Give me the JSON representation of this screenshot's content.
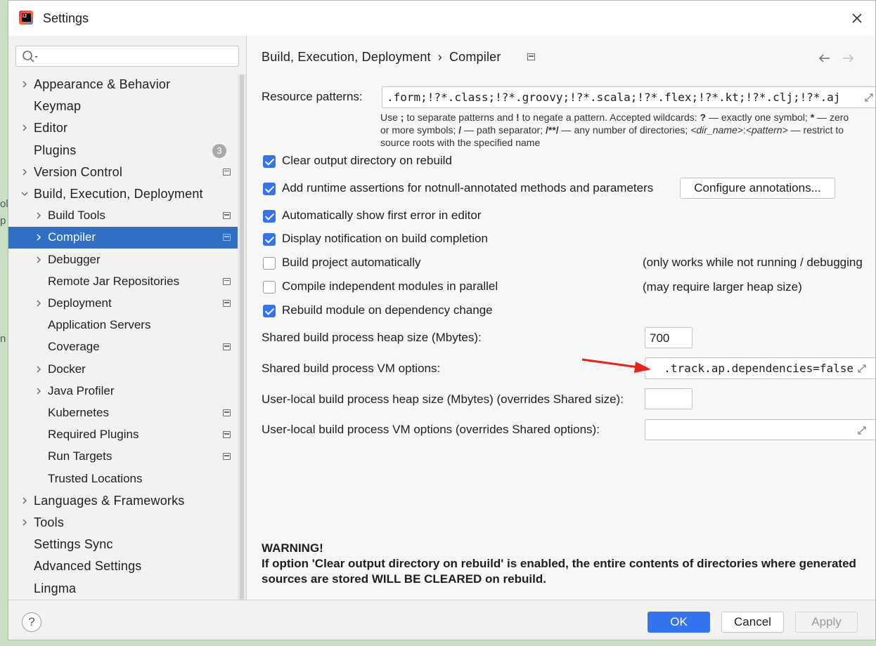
{
  "window": {
    "title": "Settings"
  },
  "background_text": [
    "ol",
    "p",
    "n"
  ],
  "sidebar": {
    "search_placeholder": "",
    "items": [
      {
        "label": "Appearance & Behavior",
        "level": 0,
        "expandable": true
      },
      {
        "label": "Keymap",
        "level": 0,
        "expandable": false
      },
      {
        "label": "Editor",
        "level": 0,
        "expandable": true
      },
      {
        "label": "Plugins",
        "level": 0,
        "expandable": false,
        "badge": "3"
      },
      {
        "label": "Version Control",
        "level": 0,
        "expandable": true,
        "project_icon": true
      },
      {
        "label": "Build, Execution, Deployment",
        "level": 0,
        "expanded": true
      },
      {
        "label": "Build Tools",
        "level": 1,
        "expandable": true,
        "project_icon": true
      },
      {
        "label": "Compiler",
        "level": 1,
        "expandable": true,
        "project_icon": true,
        "selected": true
      },
      {
        "label": "Debugger",
        "level": 1,
        "expandable": true
      },
      {
        "label": "Remote Jar Repositories",
        "level": 1,
        "project_icon": true
      },
      {
        "label": "Deployment",
        "level": 1,
        "expandable": true,
        "project_icon": true
      },
      {
        "label": "Application Servers",
        "level": 1
      },
      {
        "label": "Coverage",
        "level": 1,
        "project_icon": true
      },
      {
        "label": "Docker",
        "level": 1,
        "expandable": true
      },
      {
        "label": "Java Profiler",
        "level": 1,
        "expandable": true
      },
      {
        "label": "Kubernetes",
        "level": 1,
        "project_icon": true
      },
      {
        "label": "Required Plugins",
        "level": 1,
        "project_icon": true
      },
      {
        "label": "Run Targets",
        "level": 1,
        "project_icon": true
      },
      {
        "label": "Trusted Locations",
        "level": 1
      },
      {
        "label": "Languages & Frameworks",
        "level": 0,
        "expandable": true
      },
      {
        "label": "Tools",
        "level": 0,
        "expandable": true
      },
      {
        "label": "Settings Sync",
        "level": 0
      },
      {
        "label": "Advanced Settings",
        "level": 0
      },
      {
        "label": "Lingma",
        "level": 0
      }
    ]
  },
  "breadcrumb": {
    "parent": "Build, Execution, Deployment",
    "separator": "›",
    "current": "Compiler"
  },
  "resource_patterns": {
    "label": "Resource patterns:",
    "value": ".form;!?*.class;!?*.groovy;!?*.scala;!?*.flex;!?*.kt;!?*.clj;!?*.aj",
    "hint_line1_a": "Use ",
    "hint_line1_b": ";",
    "hint_line1_c": " to separate patterns and ",
    "hint_line1_d": "!",
    "hint_line1_e": " to negate a pattern. Accepted wildcards: ",
    "hint_line1_f": "?",
    "hint_line1_g": " — exactly one symbol; ",
    "hint_line1_h": "*",
    "hint_line1_i": " — zero",
    "hint_line2_a": "or more symbols; ",
    "hint_line2_b": "/",
    "hint_line2_c": " — path separator; ",
    "hint_line2_d": "/**/",
    "hint_line2_e": " — any number of directories; ",
    "hint_line2_f": "<dir_name>",
    "hint_line2_g": ":",
    "hint_line2_h": "<pattern>",
    "hint_line2_i": " — restrict to",
    "hint_line3": "source roots with the specified name"
  },
  "options": {
    "clear_output": {
      "label": "Clear output directory on rebuild",
      "checked": true
    },
    "runtime_assertions": {
      "label": "Add runtime assertions for notnull-annotated methods and parameters",
      "checked": true
    },
    "configure_annotations_button": "Configure annotations...",
    "show_first_error": {
      "label": "Automatically show first error in editor",
      "checked": true
    },
    "display_notification": {
      "label": "Display notification on build completion",
      "checked": true
    },
    "build_automatically": {
      "label": "Build project automatically",
      "checked": false,
      "note": "(only works while not running / debugging"
    },
    "compile_parallel": {
      "label": "Compile independent modules in parallel",
      "checked": false,
      "note": "(may require larger heap size)"
    },
    "rebuild_on_dependency": {
      "label": "Rebuild module on dependency change",
      "checked": true
    }
  },
  "heap": {
    "shared_label": "Shared build process heap size (Mbytes):",
    "shared_value": "700",
    "user_label": "User-local build process heap size (Mbytes) (overrides Shared size):",
    "user_value": ""
  },
  "vm": {
    "shared_label": "Shared build process VM options:",
    "shared_value": ".track.ap.dependencies=false",
    "user_label": "User-local build process VM options (overrides Shared options):",
    "user_value": ""
  },
  "warning": {
    "title": "WARNING!",
    "body": "If option 'Clear output directory on rebuild' is enabled, the entire contents of directories where generated sources are stored WILL BE CLEARED on rebuild."
  },
  "footer": {
    "help": "?",
    "ok": "OK",
    "cancel": "Cancel",
    "apply": "Apply"
  },
  "colors": {
    "accent": "#3574f0",
    "selection": "#2f6fc5",
    "arrow": "#e8221b"
  }
}
